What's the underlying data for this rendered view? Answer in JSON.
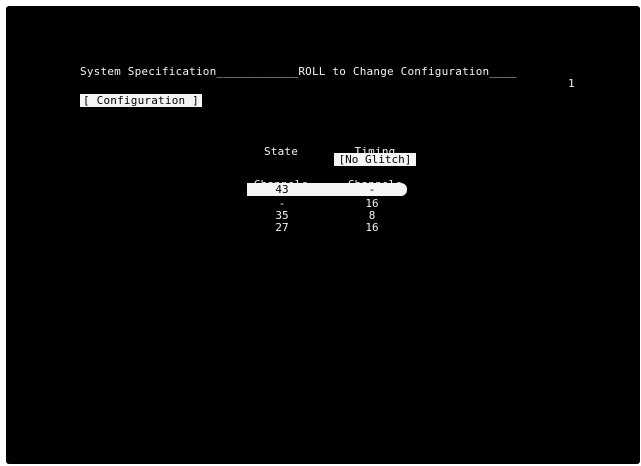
{
  "header": {
    "title": "System Specification____________ROLL to Change Configuration____",
    "page_number": "1"
  },
  "config_button": {
    "label": "[ Configuration ]"
  },
  "columns": {
    "state": {
      "line1": "State",
      "line2": "Channels"
    },
    "timing": {
      "line1": "Timing",
      "line2": "Channels"
    },
    "timing_mode": "[No Glitch]"
  },
  "rows": [
    {
      "state": "43",
      "timing": "-",
      "selected": true
    },
    {
      "state": "-",
      "timing": "16",
      "selected": false
    },
    {
      "state": "35",
      "timing": "8",
      "selected": false
    },
    {
      "state": "27",
      "timing": "16",
      "selected": false
    }
  ]
}
